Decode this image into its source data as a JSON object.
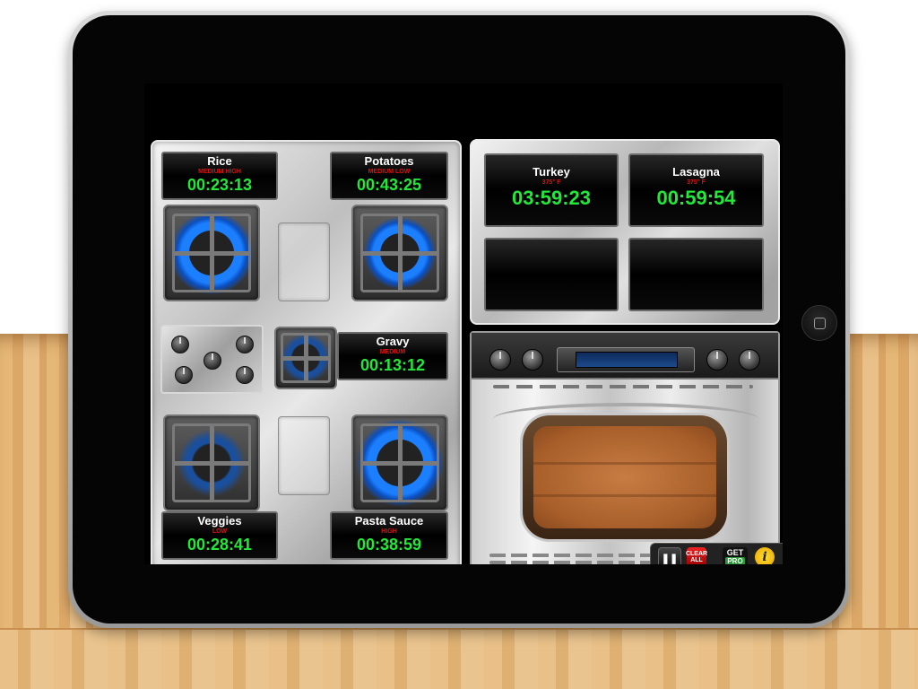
{
  "stovetop": {
    "burners": [
      {
        "id": "rice",
        "name": "Rice",
        "level": "MEDIUM HIGH",
        "time": "00:23:13"
      },
      {
        "id": "potatoes",
        "name": "Potatoes",
        "level": "MEDIUM LOW",
        "time": "00:43:25"
      },
      {
        "id": "gravy",
        "name": "Gravy",
        "level": "MEDIUM",
        "time": "00:13:12"
      },
      {
        "id": "veggies",
        "name": "Veggies",
        "level": "LOW",
        "time": "00:28:41"
      },
      {
        "id": "pasta-sauce",
        "name": "Pasta Sauce",
        "level": "HIGH",
        "time": "00:38:59"
      }
    ]
  },
  "oven": {
    "slots": [
      {
        "name": "Turkey",
        "temp": "375° F",
        "time": "03:59:23"
      },
      {
        "name": "Lasagna",
        "temp": "375° F",
        "time": "00:59:54"
      },
      {
        "name": "",
        "temp": "",
        "time": ""
      },
      {
        "name": "",
        "temp": "",
        "time": ""
      }
    ]
  },
  "controls": {
    "pause_icon": "pause-icon",
    "pause_glyph": "❚❚",
    "clear_label": "CLEAR ALL",
    "get_label": "GET",
    "pro_label": "PRO",
    "info_glyph": "i"
  },
  "colors": {
    "timer_digits": "#22e83a",
    "level_text": "#e01010",
    "flame": "#1b7fff"
  }
}
